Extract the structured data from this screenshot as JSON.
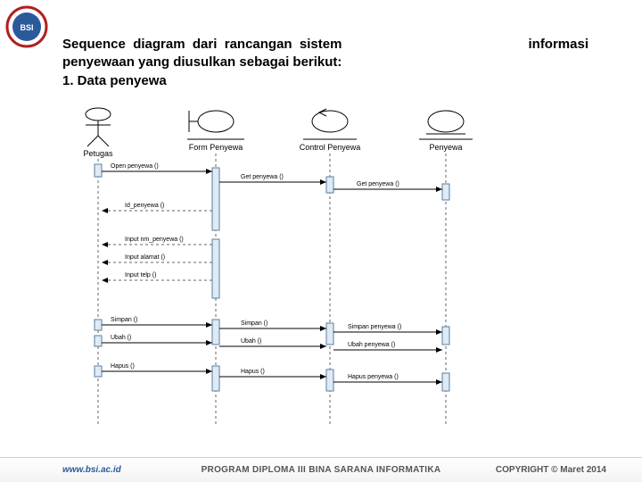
{
  "heading": {
    "part_a": "Sequence  diagram  dari  rancangan  sistem",
    "part_b": "informasi",
    "line2": "penyewaan yang diusulkan  sebagai berikut:",
    "line3": "1. Data penyewa"
  },
  "actors": {
    "petugas": "Petugas",
    "form": "Form Penyewa",
    "control": "Control Penyewa",
    "entity": "Penyewa"
  },
  "messages": {
    "m1": "Open penyewa ()",
    "m2": "Get penyewa ()",
    "m3": "Get penyewa ()",
    "m4": "Id_penyewa ()",
    "m5": "Input nm_penyewa ()",
    "m6": "Input alamat ()",
    "m7": "Input telp ()",
    "m8": "Simpan ()",
    "m9": "Simpan ()",
    "m10": "Simpan penyewa ()",
    "m11": "Ubah ()",
    "m12": "Ubah ()",
    "m13": "Ubah penyewa ()",
    "m14": "Hapus ()",
    "m15": "Hapus ()",
    "m16": "Hapus penyewa ()"
  },
  "footer": {
    "url": "www.bsi.ac.id",
    "program": "PROGRAM DIPLOMA III BINA SARANA INFORMATIKA",
    "copyright": "COPYRIGHT © Maret 2014"
  }
}
